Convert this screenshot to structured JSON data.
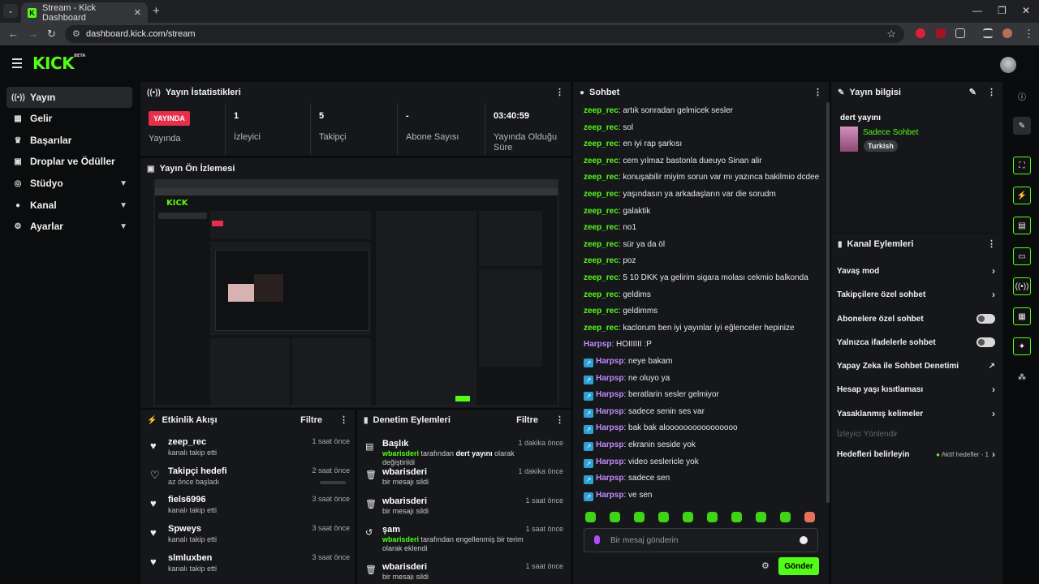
{
  "browser": {
    "tab_title": "Stream - Kick Dashboard",
    "url": "dashboard.kick.com/stream",
    "new_tab": "+",
    "tab_close": "✕"
  },
  "brand": {
    "logo": "KICK",
    "beta": "BETA"
  },
  "sidebar": {
    "items": [
      {
        "label": "Yayın",
        "icon": "broadcast-icon"
      },
      {
        "label": "Gelir",
        "icon": "revenue-icon"
      },
      {
        "label": "Başarılar",
        "icon": "trophy-icon"
      },
      {
        "label": "Droplar ve Ödüller",
        "icon": "gift-icon"
      },
      {
        "label": "Stüdyo",
        "icon": "studio-icon"
      },
      {
        "label": "Kanal",
        "icon": "channel-icon"
      },
      {
        "label": "Ayarlar",
        "icon": "gear-icon"
      }
    ]
  },
  "stats": {
    "title": "Yayın İstatistikleri",
    "live_badge": "YAYINDA",
    "live_label": "Yayında",
    "viewers": "1",
    "viewers_label": "İzleyici",
    "followers": "5",
    "followers_label": "Takipçi",
    "subs": "-",
    "subs_label": "Abone Sayısı",
    "uptime": "03:40:59",
    "uptime_label": "Yayında Olduğu Süre"
  },
  "preview": {
    "title": "Yayın Ön İzlemesi"
  },
  "activity": {
    "title": "Etkinlik Akışı",
    "filter": "Filtre",
    "rows": [
      {
        "user": "zeep_rec",
        "text": "kanalı takip etti",
        "time": "1 saat önce"
      },
      {
        "user": "Takipçi hedefi",
        "text": "az önce başladı",
        "time": "2 saat önce"
      },
      {
        "user": "fiels6996",
        "text": "kanalı takip etti",
        "time": "3 saat önce"
      },
      {
        "user": "Spweys",
        "text": "kanalı takip etti",
        "time": "3 saat önce"
      },
      {
        "user": "slmluxben",
        "text": "kanalı takip etti",
        "time": "3 saat önce"
      }
    ]
  },
  "moderation": {
    "title": "Denetim Eylemleri",
    "filter": "Filtre",
    "rows": [
      {
        "title": "Başlık",
        "actor": "wbarisderi",
        "pre": " tarafından ",
        "bold": "dert yayını",
        "post": " olarak değiştirildi",
        "time": "1 dakika önce"
      },
      {
        "title": "wbarisderi",
        "actor": "",
        "pre": "bir mesajı sildi",
        "bold": "",
        "post": "",
        "time": "1 dakika önce"
      },
      {
        "title": "wbarisderi",
        "actor": "",
        "pre": "bir mesajı sildi",
        "bold": "",
        "post": "",
        "time": "1 saat önce"
      },
      {
        "title": "şam",
        "actor": "wbarisderi",
        "pre": " tarafından engellenmiş bir terim olarak eklendi",
        "bold": "",
        "post": "",
        "time": "1 saat önce"
      },
      {
        "title": "wbarisderi",
        "actor": "",
        "pre": "bir mesajı sildi",
        "bold": "",
        "post": "",
        "time": "1 saat önce"
      }
    ]
  },
  "chat": {
    "title": "Sohbet",
    "placeholder": "Bir mesaj gönderin",
    "send": "Gönder",
    "messages": [
      {
        "user": "zeep_rec",
        "text": ": artık sonradan gelmicek sesler",
        "badge": false
      },
      {
        "user": "zeep_rec",
        "text": ": sol",
        "badge": false
      },
      {
        "user": "zeep_rec",
        "text": ": en iyi rap şarkısı",
        "badge": false
      },
      {
        "user": "zeep_rec",
        "text": ": cem yılmaz bastonla dueuyo Sinan alir",
        "badge": false
      },
      {
        "user": "zeep_rec",
        "text": ": konuşabilir miyim sorun var mı yazınca bakilmio dcdee",
        "badge": false
      },
      {
        "user": "zeep_rec",
        "text": ": yaşındasın ya arkadaşların var die sorudm",
        "badge": false
      },
      {
        "user": "zeep_rec",
        "text": ": galaktik",
        "badge": false
      },
      {
        "user": "zeep_rec",
        "text": ": no1",
        "badge": false
      },
      {
        "user": "zeep_rec",
        "text": ": sür ya da öl",
        "badge": false
      },
      {
        "user": "zeep_rec",
        "text": ": poz",
        "badge": false
      },
      {
        "user": "zeep_rec",
        "text": ": 5 10 DKK ya gelirim sigara molası cekmio balkonda",
        "badge": false
      },
      {
        "user": "zeep_rec",
        "text": ": geldims",
        "badge": false
      },
      {
        "user": "zeep_rec",
        "text": ": geldimms",
        "badge": false
      },
      {
        "user": "zeep_rec",
        "text": ": kaclorum ben iyi yayınlar iyi eğlenceler hepinize",
        "badge": false
      },
      {
        "user": "Harpsp",
        "text": ": HOIIIIII :P",
        "badge": false
      },
      {
        "user": "Harpsp",
        "text": ": neye bakam",
        "badge": true
      },
      {
        "user": "Harpsp",
        "text": ": ne oluyo ya",
        "badge": true
      },
      {
        "user": "Harpsp",
        "text": ": beratlarin sesler gelmiyor",
        "badge": true
      },
      {
        "user": "Harpsp",
        "text": ": sadece senin ses var",
        "badge": true
      },
      {
        "user": "Harpsp",
        "text": ": bak bak aloooooooooooooooo",
        "badge": true
      },
      {
        "user": "Harpsp",
        "text": ": ekranin seside yok",
        "badge": true
      },
      {
        "user": "Harpsp",
        "text": ": video seslericle yok",
        "badge": true
      },
      {
        "user": "Harpsp",
        "text": ": sadece sen",
        "badge": true
      },
      {
        "user": "Harpsp",
        "text": ": ve sen",
        "badge": true
      }
    ]
  },
  "stream_info": {
    "title": "Yayın bilgisi",
    "stream_title": "dert yayını",
    "category": "Sadece Sohbet",
    "tag": "Turkish"
  },
  "channel_actions": {
    "title": "Kanal Eylemleri",
    "rows": [
      {
        "label": "Yavaş mod",
        "kind": "chevron"
      },
      {
        "label": "Takipçilere özel sohbet",
        "kind": "chevron"
      },
      {
        "label": "Abonelere özel sohbet",
        "kind": "toggle"
      },
      {
        "label": "Yalnızca ifadelerle sohbet",
        "kind": "toggle"
      },
      {
        "label": "Yapay Zeka ile Sohbet Denetimi",
        "kind": "external"
      },
      {
        "label": "Hesap yaşı kısıtlaması",
        "kind": "chevron"
      },
      {
        "label": "Yasaklanmış kelimeler",
        "kind": "chevron"
      }
    ],
    "redirect": "İzleyici Yönlendir",
    "goals": "Hedefleri belirleyin",
    "goals_status": "Aktif hedefler - 1"
  },
  "colors": {
    "accent": "#53fc18",
    "live": "#e62f4a",
    "panel": "#16171a"
  }
}
